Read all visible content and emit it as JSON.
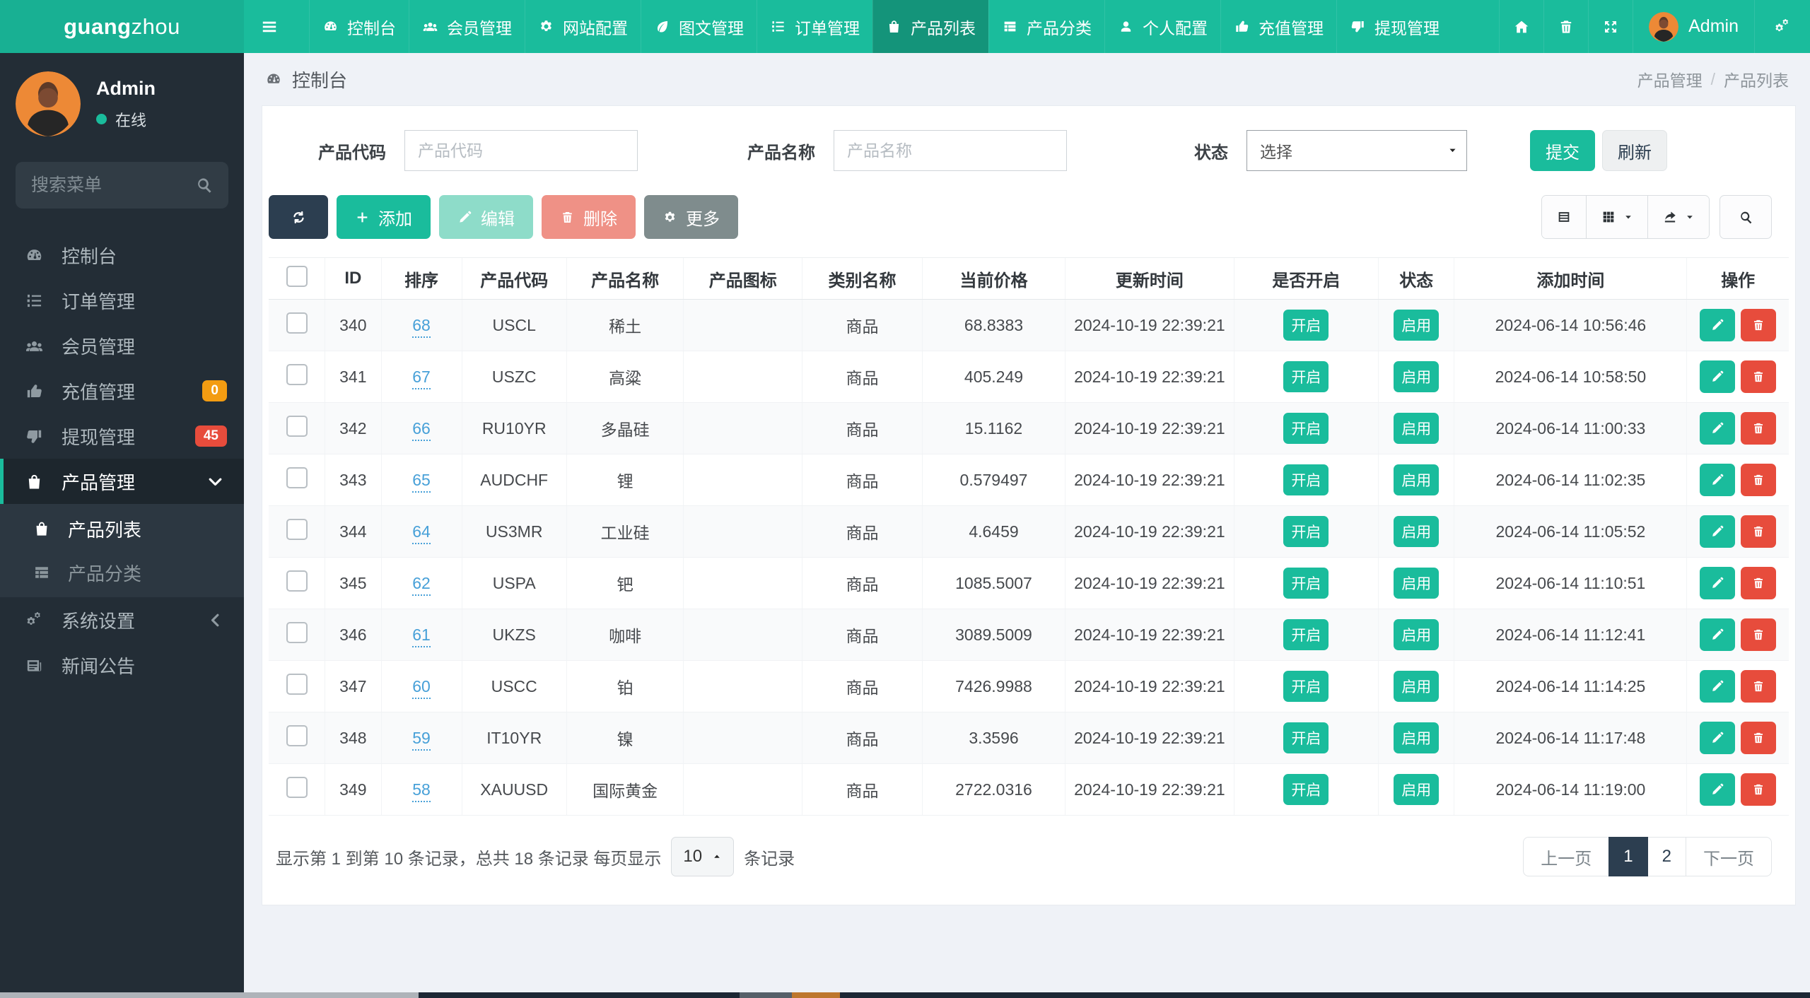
{
  "brand": {
    "bold": "guang",
    "light": "zhou"
  },
  "colors": {
    "accent": "#1abc9c",
    "navy": "#2c3e50",
    "danger": "#e74c3c",
    "warning": "#f39c12"
  },
  "topnav": {
    "items": [
      {
        "name": "nav-dashboard",
        "icon": "gauge",
        "label": "控制台",
        "active": false
      },
      {
        "name": "nav-members",
        "icon": "users",
        "label": "会员管理",
        "active": false
      },
      {
        "name": "nav-site-config",
        "icon": "gear",
        "label": "网站配置",
        "active": false
      },
      {
        "name": "nav-content",
        "icon": "leaf",
        "label": "图文管理",
        "active": false
      },
      {
        "name": "nav-orders",
        "icon": "list-ol",
        "label": "订单管理",
        "active": false
      },
      {
        "name": "nav-product-list",
        "icon": "bag",
        "label": "产品列表",
        "active": true
      },
      {
        "name": "nav-product-category",
        "icon": "th-list",
        "label": "产品分类",
        "active": false
      },
      {
        "name": "nav-profile",
        "icon": "user",
        "label": "个人配置",
        "active": false
      },
      {
        "name": "nav-recharge",
        "icon": "thumbs-up",
        "label": "充值管理",
        "active": false
      },
      {
        "name": "nav-withdraw",
        "icon": "thumbs-down",
        "label": "提现管理",
        "active": false
      }
    ],
    "right_icons": [
      {
        "name": "home-button",
        "icon": "home"
      },
      {
        "name": "trash-button",
        "icon": "trash"
      },
      {
        "name": "fullscreen-button",
        "icon": "expand"
      }
    ],
    "user": {
      "label": "Admin"
    }
  },
  "sidebar": {
    "user": {
      "name": "Admin",
      "status": "在线"
    },
    "search": {
      "placeholder": "搜索菜单"
    },
    "items": [
      {
        "name": "sidebar-dashboard",
        "icon": "gauge",
        "label": "控制台"
      },
      {
        "name": "sidebar-orders",
        "icon": "list-ol",
        "label": "订单管理"
      },
      {
        "name": "sidebar-members",
        "icon": "users",
        "label": "会员管理"
      },
      {
        "name": "sidebar-recharge",
        "icon": "thumbs-up",
        "label": "充值管理",
        "badge": "0",
        "badge_color": "#f39c12"
      },
      {
        "name": "sidebar-withdraw",
        "icon": "thumbs-down",
        "label": "提现管理",
        "badge": "45",
        "badge_color": "#e74c3c"
      },
      {
        "name": "sidebar-products",
        "icon": "bag",
        "label": "产品管理",
        "active": true,
        "chevron": "down",
        "children": [
          {
            "name": "sidebar-product-list",
            "icon": "bag",
            "label": "产品列表",
            "active": true
          },
          {
            "name": "sidebar-product-category",
            "icon": "th-list",
            "label": "产品分类"
          }
        ]
      },
      {
        "name": "sidebar-system",
        "icon": "gears",
        "label": "系统设置",
        "chevron": "left"
      },
      {
        "name": "sidebar-news",
        "icon": "newspaper",
        "label": "新闻公告"
      }
    ]
  },
  "page_header": {
    "title": "控制台",
    "breadcrumb": [
      "产品管理",
      "产品列表"
    ],
    "breadcrumb_sep": "/"
  },
  "filters": {
    "code": {
      "label": "产品代码",
      "placeholder": "产品代码"
    },
    "name": {
      "label": "产品名称",
      "placeholder": "产品名称"
    },
    "status": {
      "label": "状态",
      "value": "选择"
    },
    "submit": "提交",
    "refresh": "刷新"
  },
  "toolbar": {
    "add": "添加",
    "edit": "编辑",
    "del": "删除",
    "more": "更多"
  },
  "table": {
    "columns": [
      "ID",
      "排序",
      "产品代码",
      "产品名称",
      "产品图标",
      "类别名称",
      "当前价格",
      "更新时间",
      "是否开启",
      "状态",
      "添加时间",
      "操作"
    ],
    "rows": [
      {
        "id": "340",
        "sort": "68",
        "code": "USCL",
        "name": "稀土",
        "icon": "",
        "category": "商品",
        "price": "68.8383",
        "updated": "2024-10-19 22:39:21",
        "open": "开启",
        "status": "启用",
        "added": "2024-06-14 10:56:46"
      },
      {
        "id": "341",
        "sort": "67",
        "code": "USZC",
        "name": "高粱",
        "icon": "",
        "category": "商品",
        "price": "405.249",
        "updated": "2024-10-19 22:39:21",
        "open": "开启",
        "status": "启用",
        "added": "2024-06-14 10:58:50"
      },
      {
        "id": "342",
        "sort": "66",
        "code": "RU10YR",
        "name": "多晶硅",
        "icon": "",
        "category": "商品",
        "price": "15.1162",
        "updated": "2024-10-19 22:39:21",
        "open": "开启",
        "status": "启用",
        "added": "2024-06-14 11:00:33"
      },
      {
        "id": "343",
        "sort": "65",
        "code": "AUDCHF",
        "name": "锂",
        "icon": "",
        "category": "商品",
        "price": "0.579497",
        "updated": "2024-10-19 22:39:21",
        "open": "开启",
        "status": "启用",
        "added": "2024-06-14 11:02:35"
      },
      {
        "id": "344",
        "sort": "64",
        "code": "US3MR",
        "name": "工业硅",
        "icon": "",
        "category": "商品",
        "price": "4.6459",
        "updated": "2024-10-19 22:39:21",
        "open": "开启",
        "status": "启用",
        "added": "2024-06-14 11:05:52"
      },
      {
        "id": "345",
        "sort": "62",
        "code": "USPA",
        "name": "钯",
        "icon": "",
        "category": "商品",
        "price": "1085.5007",
        "updated": "2024-10-19 22:39:21",
        "open": "开启",
        "status": "启用",
        "added": "2024-06-14 11:10:51"
      },
      {
        "id": "346",
        "sort": "61",
        "code": "UKZS",
        "name": "咖啡",
        "icon": "",
        "category": "商品",
        "price": "3089.5009",
        "updated": "2024-10-19 22:39:21",
        "open": "开启",
        "status": "启用",
        "added": "2024-06-14 11:12:41"
      },
      {
        "id": "347",
        "sort": "60",
        "code": "USCC",
        "name": "铂",
        "icon": "",
        "category": "商品",
        "price": "7426.9988",
        "updated": "2024-10-19 22:39:21",
        "open": "开启",
        "status": "启用",
        "added": "2024-06-14 11:14:25"
      },
      {
        "id": "348",
        "sort": "59",
        "code": "IT10YR",
        "name": "镍",
        "icon": "",
        "category": "商品",
        "price": "3.3596",
        "updated": "2024-10-19 22:39:21",
        "open": "开启",
        "status": "启用",
        "added": "2024-06-14 11:17:48"
      },
      {
        "id": "349",
        "sort": "58",
        "code": "XAUUSD",
        "name": "国际黄金",
        "icon": "",
        "category": "商品",
        "price": "2722.0316",
        "updated": "2024-10-19 22:39:21",
        "open": "开启",
        "status": "启用",
        "added": "2024-06-14 11:19:00"
      }
    ]
  },
  "pagination": {
    "summary_prefix": "显示第 1 到第 10 条记录，总共 18 条记录 每页显示",
    "page_size": "10",
    "summary_suffix": "条记录",
    "prev": "上一页",
    "pages": [
      "1",
      "2"
    ],
    "active_page": "1",
    "next": "下一页"
  }
}
